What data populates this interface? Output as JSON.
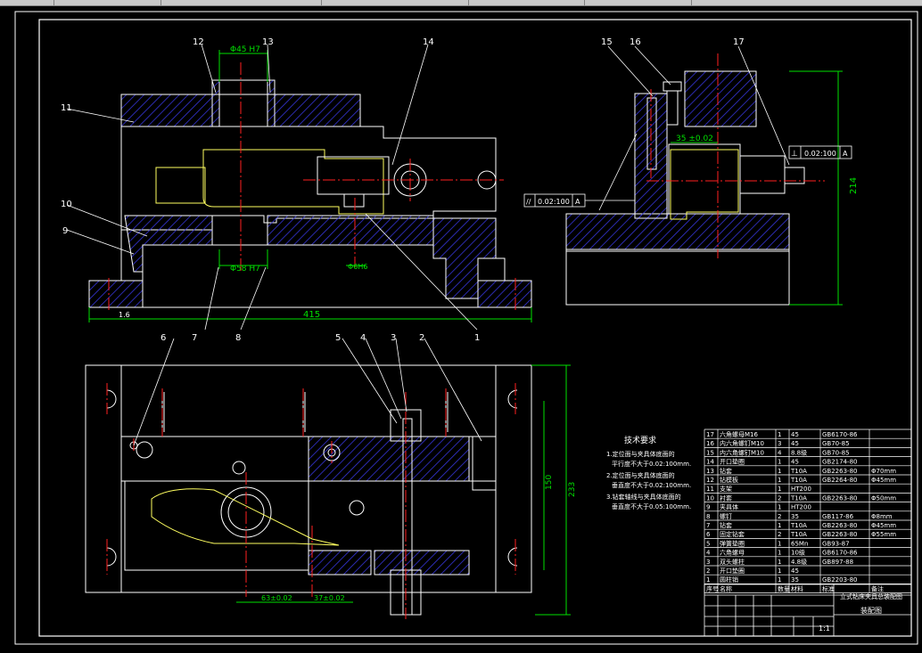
{
  "colors": {
    "bg": "#000000",
    "line": "#ffffff",
    "center": "#ff2020",
    "dim": "#00e000",
    "hatch": "#3030d0",
    "part": "#ffff60",
    "leader": "#ffffff",
    "tab_bar": "#c8c8c8"
  },
  "balloons": {
    "b12": "12",
    "b13": "13",
    "b14": "14",
    "b11": "11",
    "b10": "10",
    "b9": "9",
    "b1": "1",
    "b7": "7",
    "b6a": "6",
    "b8": "8",
    "b15": "15",
    "b16": "16",
    "b17": "17",
    "b5": "5",
    "b4": "4",
    "b3": "3",
    "b2": "2",
    "b6b": "6"
  },
  "dims": {
    "d_top": "Φ45 H7",
    "d_mid": "Φ58 H7",
    "d_small": "Φ6H6",
    "d_len": "415",
    "d_ra": "1.6",
    "d_35": "35 ±0.02",
    "d_214": "214",
    "d_150": "150",
    "d_233": "233",
    "d_63": "63±0.02",
    "d_37": "37±0.02"
  },
  "tolerances": {
    "perp": "⊥",
    "perp_val": "0.02:100",
    "perp_ref": "A",
    "par": "//",
    "par_val": "0.02:100",
    "par_ref": "A"
  },
  "tech": {
    "title": "技术要求",
    "line1": "1.定位面与夹具体底面的",
    "line2": "平行度不大于0.02:100mm.",
    "line3": "2.定位面与夹具体底面的",
    "line4": "垂直度不大于0.02:100mm.",
    "line5": "3.钻套轴线与夹具体底面的",
    "line6": "垂直度不大于0.05:100mm."
  },
  "bom": [
    [
      "17",
      "六角螺母M16",
      "1",
      "45",
      "GB6170-86",
      ""
    ],
    [
      "16",
      "内六角螺钉M10",
      "3",
      "45",
      "GB70-85",
      ""
    ],
    [
      "15",
      "内六角螺钉M10",
      "4",
      "8.8级",
      "GB70-85",
      ""
    ],
    [
      "14",
      "开口垫圈",
      "1",
      "45",
      "GB2174-80",
      ""
    ],
    [
      "13",
      "钻套",
      "1",
      "T10A",
      "GB2263-80",
      "Φ70mm"
    ],
    [
      "12",
      "钻模板",
      "1",
      "T10A",
      "GB2264-80",
      "Φ45mm"
    ],
    [
      "11",
      "支架",
      "1",
      "HT200",
      "",
      ""
    ],
    [
      "10",
      "衬套",
      "2",
      "T10A",
      "GB2263-80",
      "Φ50mm"
    ],
    [
      "9",
      "夹具体",
      "1",
      "HT200",
      "",
      ""
    ],
    [
      "8",
      "螺钉",
      "2",
      "35",
      "GB117-86",
      "Φ8mm"
    ],
    [
      "7",
      "钻套",
      "1",
      "T10A",
      "GB2263-80",
      "Φ45mm"
    ],
    [
      "6",
      "固定钻套",
      "2",
      "T10A",
      "GB2263-80",
      "Φ55mm"
    ],
    [
      "5",
      "弹簧垫圈",
      "1",
      "65Mn",
      "GB93-87",
      ""
    ],
    [
      "4",
      "六角螺母",
      "1",
      "10级",
      "GB6170-86",
      ""
    ],
    [
      "3",
      "双头螺柱",
      "1",
      "4.8级",
      "GB897-88",
      ""
    ],
    [
      "2",
      "开口垫圈",
      "1",
      "45",
      "",
      ""
    ],
    [
      "1",
      "圆柱销",
      "1",
      "35",
      "GB2203-80",
      ""
    ]
  ],
  "bom_header": {
    "no": "序号",
    "name": "名称",
    "qty": "数量",
    "mat": "材料",
    "std": "标准",
    "note": "备注"
  },
  "title_block": {
    "drawing_name": "立式钻床夹具总装配图",
    "sheet": "装配图",
    "scale": "1:1"
  }
}
